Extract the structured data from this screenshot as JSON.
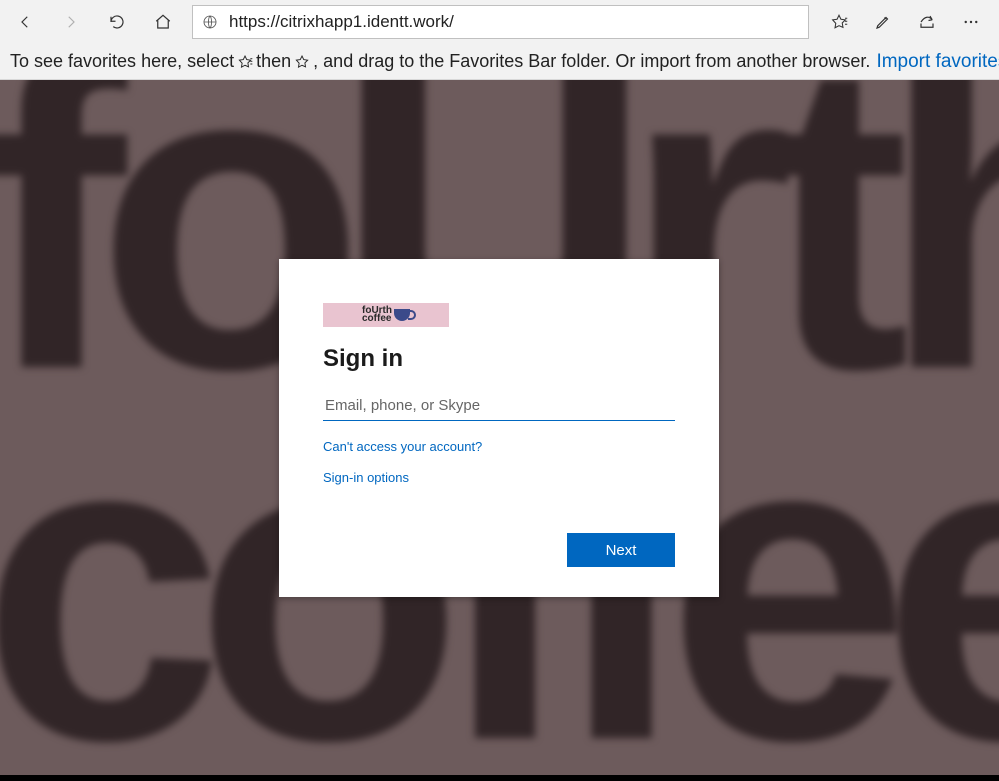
{
  "browser": {
    "url": "https://citrixhapp1.identt.work/",
    "favbar": {
      "text_before": "To see favorites here, select ",
      "text_mid": " then ",
      "text_after": ", and drag to the Favorites Bar folder. Or import from another browser.",
      "import_label": "Import favorites"
    }
  },
  "background": {
    "line1": "foUrth",
    "line2": "coffee"
  },
  "card": {
    "brand_text": "foUrth\ncoffee",
    "title": "Sign in",
    "input_placeholder": "Email, phone, or Skype",
    "cant_access": "Can't access your account?",
    "signin_options": "Sign-in options",
    "next_label": "Next"
  }
}
